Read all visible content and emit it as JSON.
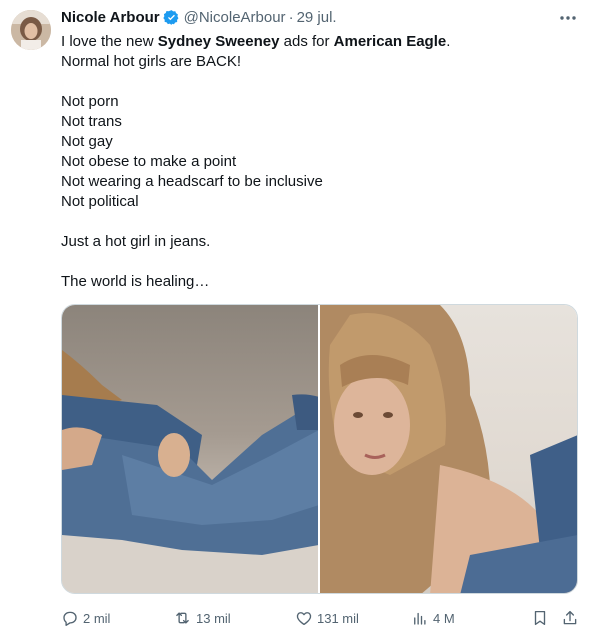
{
  "author": {
    "name": "Nicole Arbour",
    "handle": "@NicoleArbour",
    "separator": "·",
    "date": "29 jul.",
    "verified_color": "#1d9bf0"
  },
  "tweet": {
    "line1_pre": "I love the new ",
    "line1_bold1": "Sydney Sweeney",
    "line1_mid": " ads for ",
    "line1_bold2": "American Eagle",
    "line1_post": ".",
    "line2": "Normal hot girls are BACK!",
    "list": [
      "Not porn",
      "Not trans",
      "Not gay",
      "Not obese to make a point",
      "Not wearing a headscarf to be inclusive",
      "Not political"
    ],
    "line3": "Just a hot girl in jeans.",
    "line4": "The world is healing…"
  },
  "more_icon": "ellipsis-icon",
  "media": {
    "photos": [
      "photo-woman-in-denim-lying",
      "photo-woman-long-hair-portrait"
    ]
  },
  "actions": {
    "replies": "2 mil",
    "reposts": "13 mil",
    "likes": "131 mil",
    "views": "4 M",
    "icons": [
      "reply-icon",
      "retweet-icon",
      "heart-icon",
      "views-icon",
      "bookmark-icon",
      "share-icon"
    ]
  },
  "colors": {
    "text": "#0f1419",
    "secondary": "#536471",
    "accent": "#1d9bf0"
  }
}
